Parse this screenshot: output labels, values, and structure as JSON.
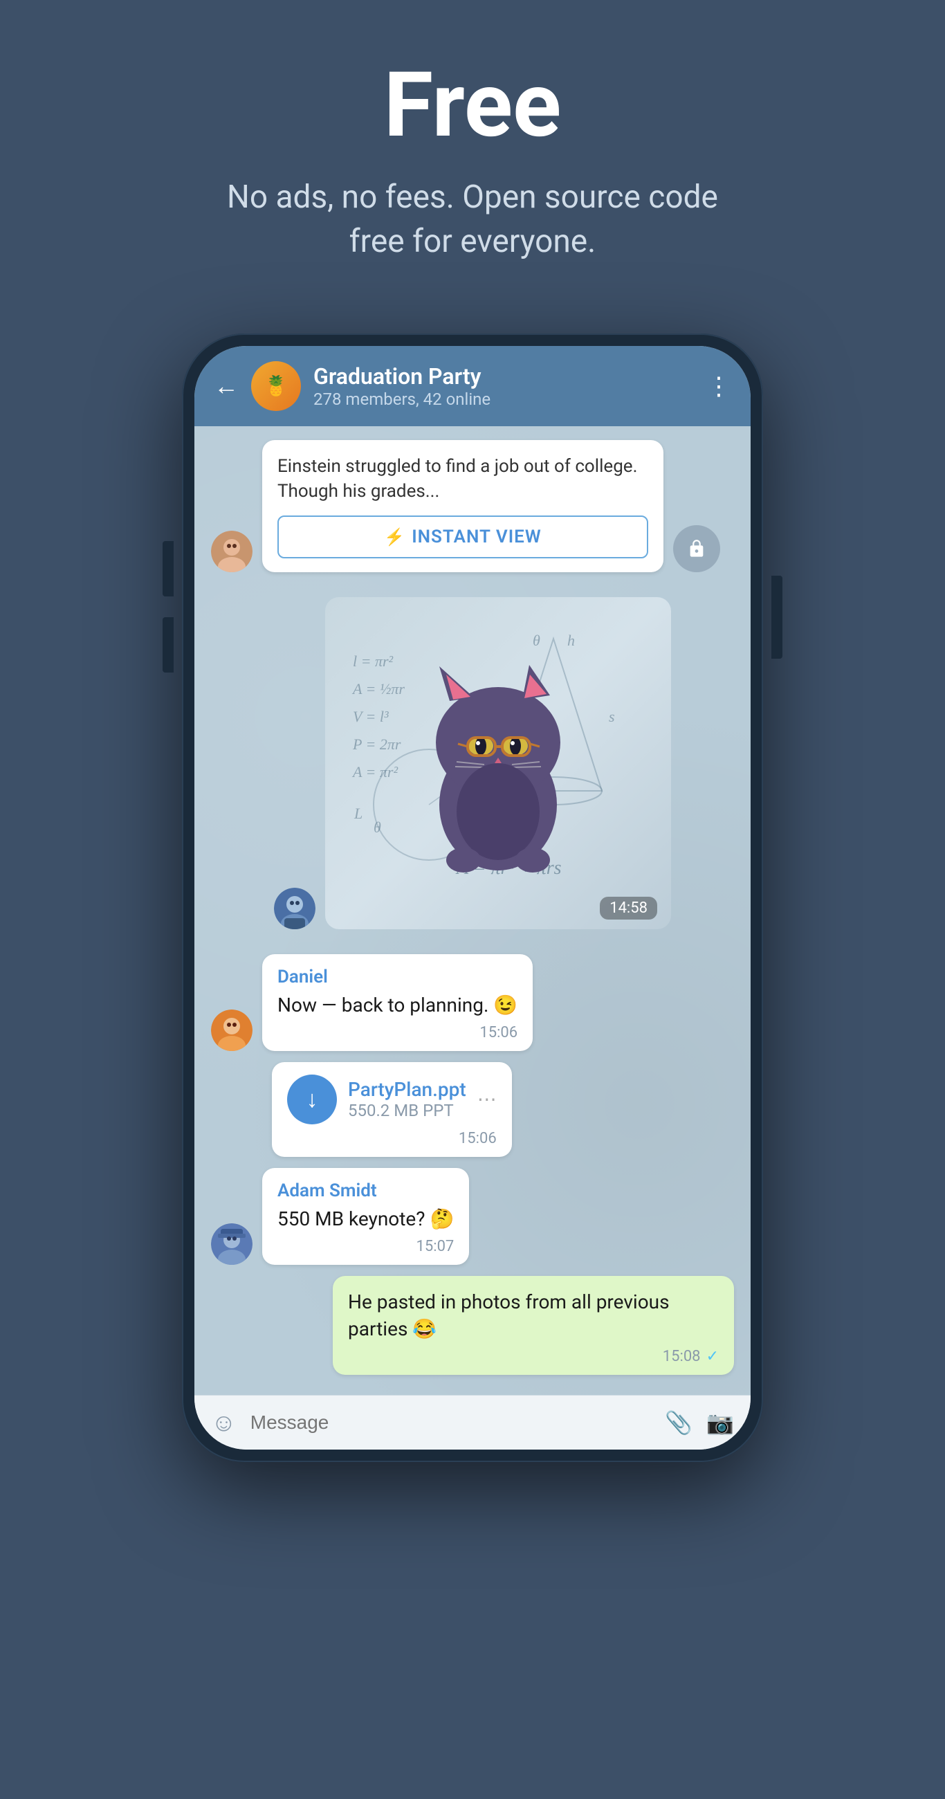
{
  "hero": {
    "title": "Free",
    "subtitle": "No ads, no fees. Open source code free for everyone."
  },
  "phone": {
    "header": {
      "back_label": "←",
      "group_name": "Graduation Party",
      "group_meta": "278 members, 42 online",
      "more_label": "⋮",
      "avatar_emoji": "🍍"
    },
    "messages": [
      {
        "id": "article-msg",
        "type": "article",
        "text": "Einstein struggled to find a job out of college. Though his grades...",
        "instant_view_label": "INSTANT VIEW",
        "instant_view_icon": "⚡"
      },
      {
        "id": "sticker-msg",
        "type": "sticker",
        "time": "14:58"
      },
      {
        "id": "daniel-msg",
        "type": "text",
        "sender": "Daniel",
        "text": "Now — back to planning. 😉",
        "time": "15:06"
      },
      {
        "id": "file-msg",
        "type": "file",
        "file_name": "PartyPlan.ppt",
        "file_size": "550.2 MB PPT",
        "time": "15:06",
        "download_icon": "↓"
      },
      {
        "id": "adam-msg",
        "type": "text",
        "sender": "Adam Smidt",
        "text": "550 MB keynote? 🤔",
        "time": "15:07"
      },
      {
        "id": "sent-msg",
        "type": "sent",
        "text": "He pasted in photos from all previous parties 😂",
        "time": "15:08",
        "check": "✓"
      }
    ],
    "input_bar": {
      "placeholder": "Message",
      "emoji_icon": "☺",
      "attachment_icon": "📎",
      "camera_icon": "📷"
    }
  }
}
